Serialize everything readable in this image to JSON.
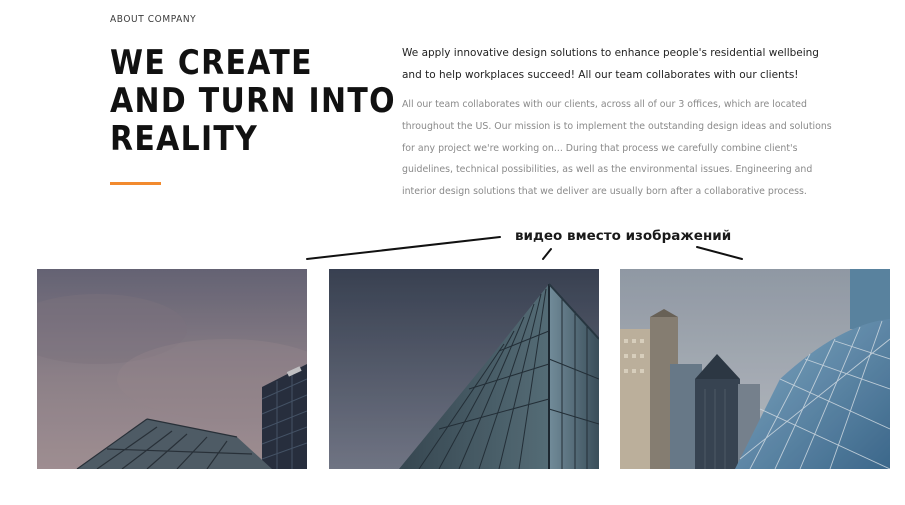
{
  "about": {
    "eyebrow": "ABOUT COMPANY",
    "headline_lines": [
      "WE CREATE",
      "AND TURN INTO",
      "REALITY"
    ],
    "accent_color": "#f28a2e"
  },
  "intro": {
    "lead": "We apply innovative design solutions to enhance people's residential wellbeing and to help workplaces succeed! All our team collaborates with our clients!",
    "body": "All our team collaborates with our clients, across all of our 3 offices, which are located throughout the US. Our mission is to implement the outstanding design ideas and solutions for any project we're working on... During that process we carefully combine client's guidelines, technical possibilities, as well as the environmental issues. Engineering and interior design solutions that we deliver are usually born after a collaborative process."
  },
  "annotation": {
    "label": "видео вместо изображений"
  },
  "gallery": {
    "tiles": [
      {
        "icon": "glass-building-corner-image"
      },
      {
        "icon": "glass-tower-facade-image"
      },
      {
        "icon": "city-skyscrapers-image"
      }
    ]
  }
}
